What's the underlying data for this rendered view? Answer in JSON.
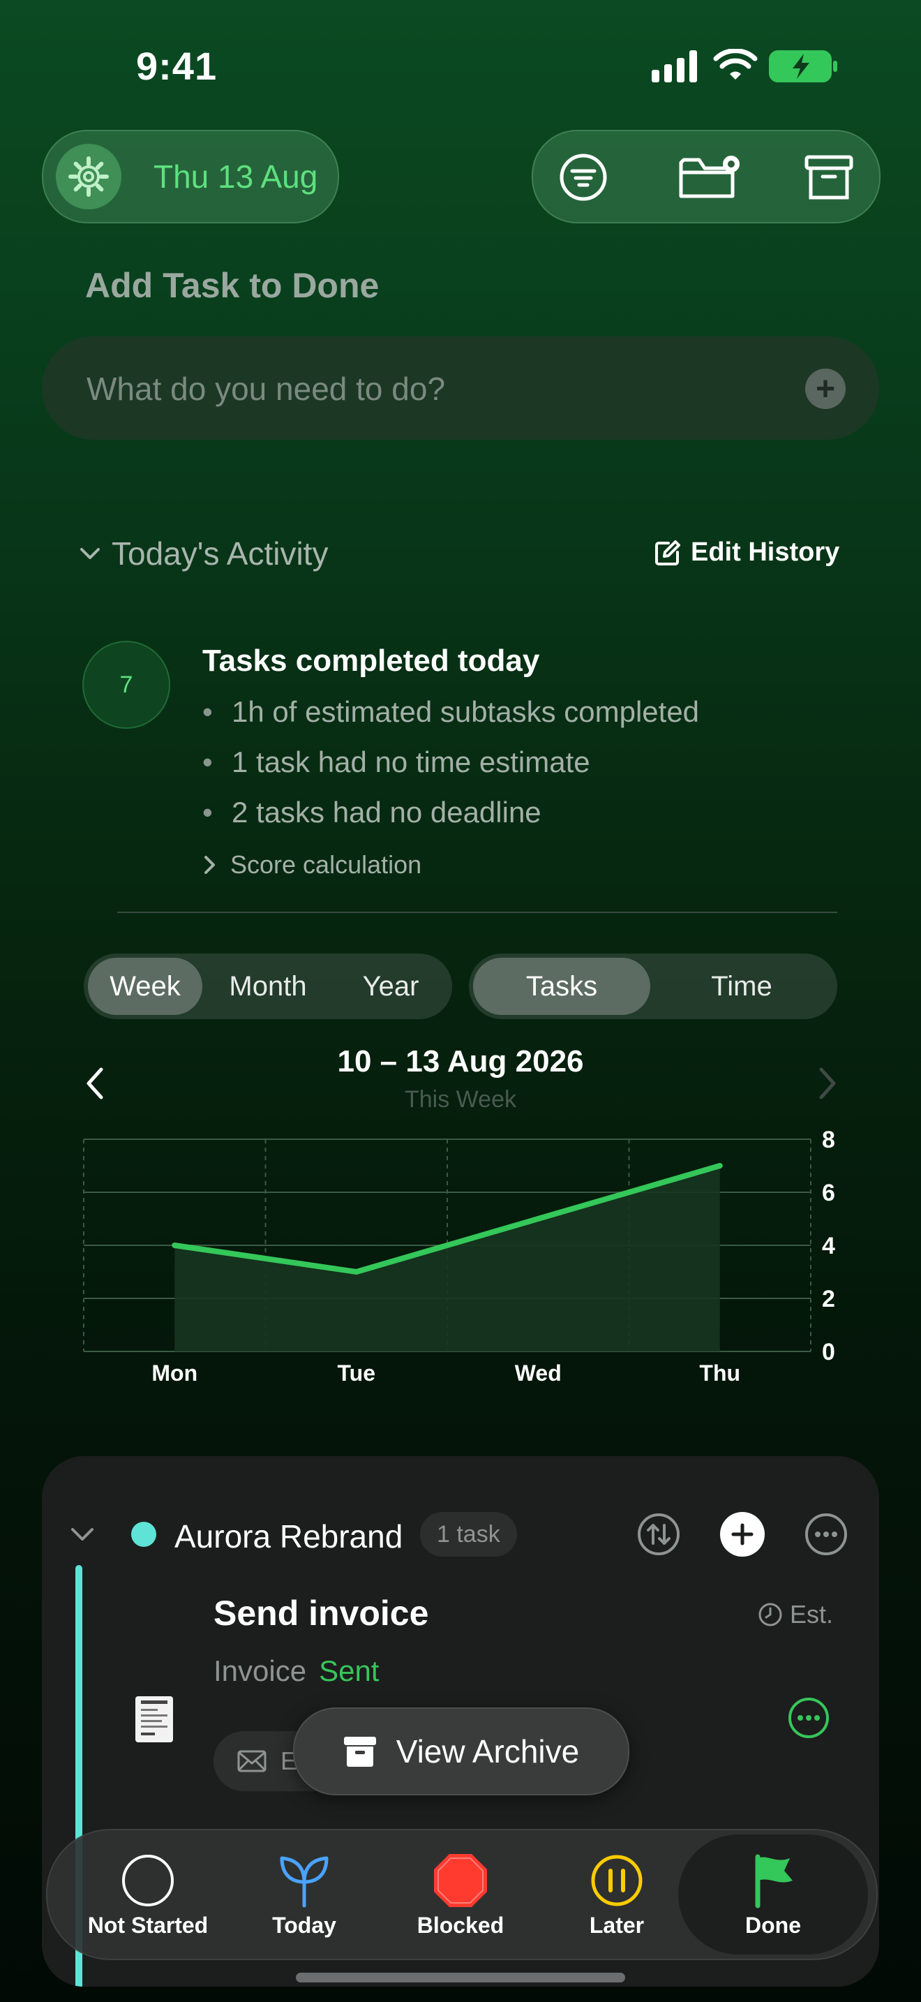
{
  "status": {
    "time": "9:41"
  },
  "header": {
    "date_label": "Thu 13 Aug"
  },
  "add_task": {
    "title": "Add Task to Done",
    "placeholder": "What do you need to do?"
  },
  "activity": {
    "toggle_label": "Today's Activity",
    "edit_history_label": "Edit History",
    "score": "7",
    "summary_title": "Tasks completed today",
    "bullets": [
      "1h of estimated subtasks completed",
      "1 task had no time estimate",
      "2 tasks had no deadline"
    ],
    "score_calc_label": "Score calculation"
  },
  "segments": {
    "range": [
      "Week",
      "Month",
      "Year"
    ],
    "range_selected": "Week",
    "metric": [
      "Tasks",
      "Time"
    ],
    "metric_selected": "Tasks"
  },
  "period": {
    "label": "10 – 13 Aug 2026",
    "sub": "This Week"
  },
  "chart_data": {
    "type": "area",
    "categories": [
      "Mon",
      "Tue",
      "Wed",
      "Thu"
    ],
    "values": [
      4,
      3,
      5,
      7
    ],
    "ylim": [
      0,
      8
    ],
    "yticks": [
      0,
      2,
      4,
      6,
      8
    ],
    "grid": true,
    "line_color": "#34c759",
    "fill_color": "#16351f"
  },
  "project": {
    "name": "Aurora Rebrand",
    "count": "1 task",
    "color": "#5ee3d6",
    "task": {
      "title": "Send invoice",
      "est": "Est.",
      "sub_label": "Invoice",
      "sub_status": "Sent",
      "chip": "E"
    }
  },
  "archive": {
    "label": "View Archive"
  },
  "tabs": [
    {
      "label": "Not Started"
    },
    {
      "label": "Today"
    },
    {
      "label": "Blocked"
    },
    {
      "label": "Later"
    },
    {
      "label": "Done"
    }
  ]
}
